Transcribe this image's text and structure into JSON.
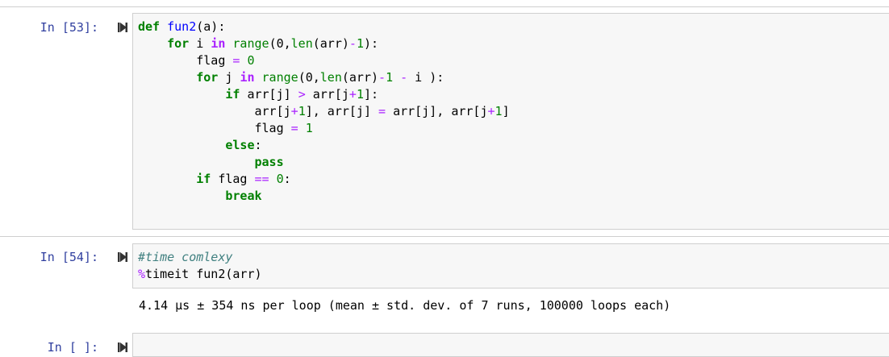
{
  "cells": [
    {
      "prompt": "In [53]:",
      "code_lines": [
        [
          [
            "kw",
            "def"
          ],
          [
            "t",
            " "
          ],
          [
            "fn",
            "fun2"
          ],
          [
            "t",
            "(a):"
          ]
        ],
        [
          [
            "t",
            "    "
          ],
          [
            "kw",
            "for"
          ],
          [
            "t",
            " i "
          ],
          [
            "opb",
            "in"
          ],
          [
            "t",
            " "
          ],
          [
            "bi",
            "range"
          ],
          [
            "t",
            "(0,"
          ],
          [
            "bi",
            "len"
          ],
          [
            "t",
            "(arr)"
          ],
          [
            "op",
            "-"
          ],
          [
            "num",
            "1"
          ],
          [
            "t",
            "):"
          ]
        ],
        [
          [
            "t",
            "        flag "
          ],
          [
            "op",
            "="
          ],
          [
            "t",
            " "
          ],
          [
            "num",
            "0"
          ]
        ],
        [
          [
            "t",
            "        "
          ],
          [
            "kw",
            "for"
          ],
          [
            "t",
            " j "
          ],
          [
            "opb",
            "in"
          ],
          [
            "t",
            " "
          ],
          [
            "bi",
            "range"
          ],
          [
            "t",
            "(0,"
          ],
          [
            "bi",
            "len"
          ],
          [
            "t",
            "(arr)"
          ],
          [
            "op",
            "-"
          ],
          [
            "num",
            "1"
          ],
          [
            "t",
            " "
          ],
          [
            "op",
            "-"
          ],
          [
            "t",
            " i ):"
          ]
        ],
        [
          [
            "t",
            "            "
          ],
          [
            "kw",
            "if"
          ],
          [
            "t",
            " arr[j] "
          ],
          [
            "op",
            ">"
          ],
          [
            "t",
            " arr[j"
          ],
          [
            "op",
            "+"
          ],
          [
            "num",
            "1"
          ],
          [
            "t",
            "]:"
          ]
        ],
        [
          [
            "t",
            "                arr[j"
          ],
          [
            "op",
            "+"
          ],
          [
            "num",
            "1"
          ],
          [
            "t",
            "], arr[j] "
          ],
          [
            "op",
            "="
          ],
          [
            "t",
            " arr[j], arr[j"
          ],
          [
            "op",
            "+"
          ],
          [
            "num",
            "1"
          ],
          [
            "t",
            "]"
          ]
        ],
        [
          [
            "t",
            "                flag "
          ],
          [
            "op",
            "="
          ],
          [
            "t",
            " "
          ],
          [
            "num",
            "1"
          ]
        ],
        [
          [
            "t",
            "            "
          ],
          [
            "kw",
            "else"
          ],
          [
            "t",
            ":"
          ]
        ],
        [
          [
            "t",
            "                "
          ],
          [
            "kw",
            "pass"
          ]
        ],
        [
          [
            "t",
            "        "
          ],
          [
            "kw",
            "if"
          ],
          [
            "t",
            " flag "
          ],
          [
            "op",
            "=="
          ],
          [
            "t",
            " "
          ],
          [
            "num",
            "0"
          ],
          [
            "t",
            ":"
          ]
        ],
        [
          [
            "t",
            "            "
          ],
          [
            "kw",
            "break"
          ]
        ]
      ]
    },
    {
      "prompt": "In [54]:",
      "code_lines": [
        [
          [
            "com",
            "#time comlexy"
          ]
        ],
        [
          [
            "magic",
            "%"
          ],
          [
            "t",
            "timeit fun2(arr)"
          ]
        ]
      ],
      "output": "4.14 µs ± 354 ns per loop (mean ± std. dev. of 7 runs, 100000 loops each)"
    },
    {
      "prompt": "In [ ]:",
      "code_lines": []
    }
  ]
}
